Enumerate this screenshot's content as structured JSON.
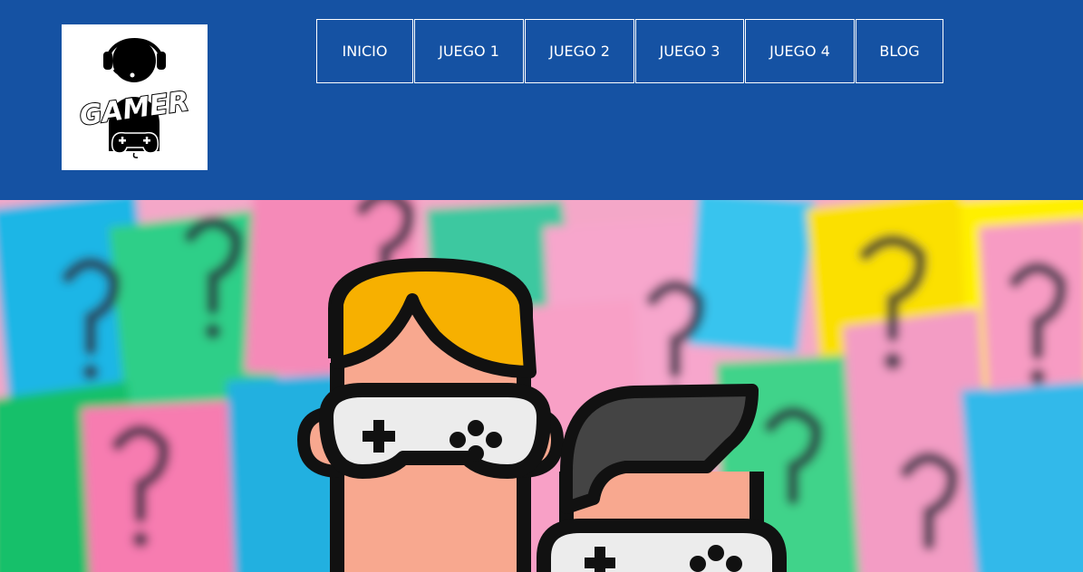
{
  "logo": {
    "text": "GAMER",
    "icon": "gamer-headset-logo"
  },
  "nav": {
    "items": [
      {
        "label": "INICIO"
      },
      {
        "label": "JUEGO 1"
      },
      {
        "label": "JUEGO 2"
      },
      {
        "label": "JUEGO 3"
      },
      {
        "label": "JUEGO 4"
      },
      {
        "label": "BLOG"
      }
    ]
  },
  "colors": {
    "header_bg": "#1552a3",
    "nav_border": "#ffffff",
    "nav_text": "#ffffff"
  },
  "hero": {
    "icons": [
      "question-mark-notes-background",
      "gamer-boy-blonde-icon",
      "gamer-boy-dark-hair-icon",
      "gamepad-goggles-icon"
    ]
  }
}
